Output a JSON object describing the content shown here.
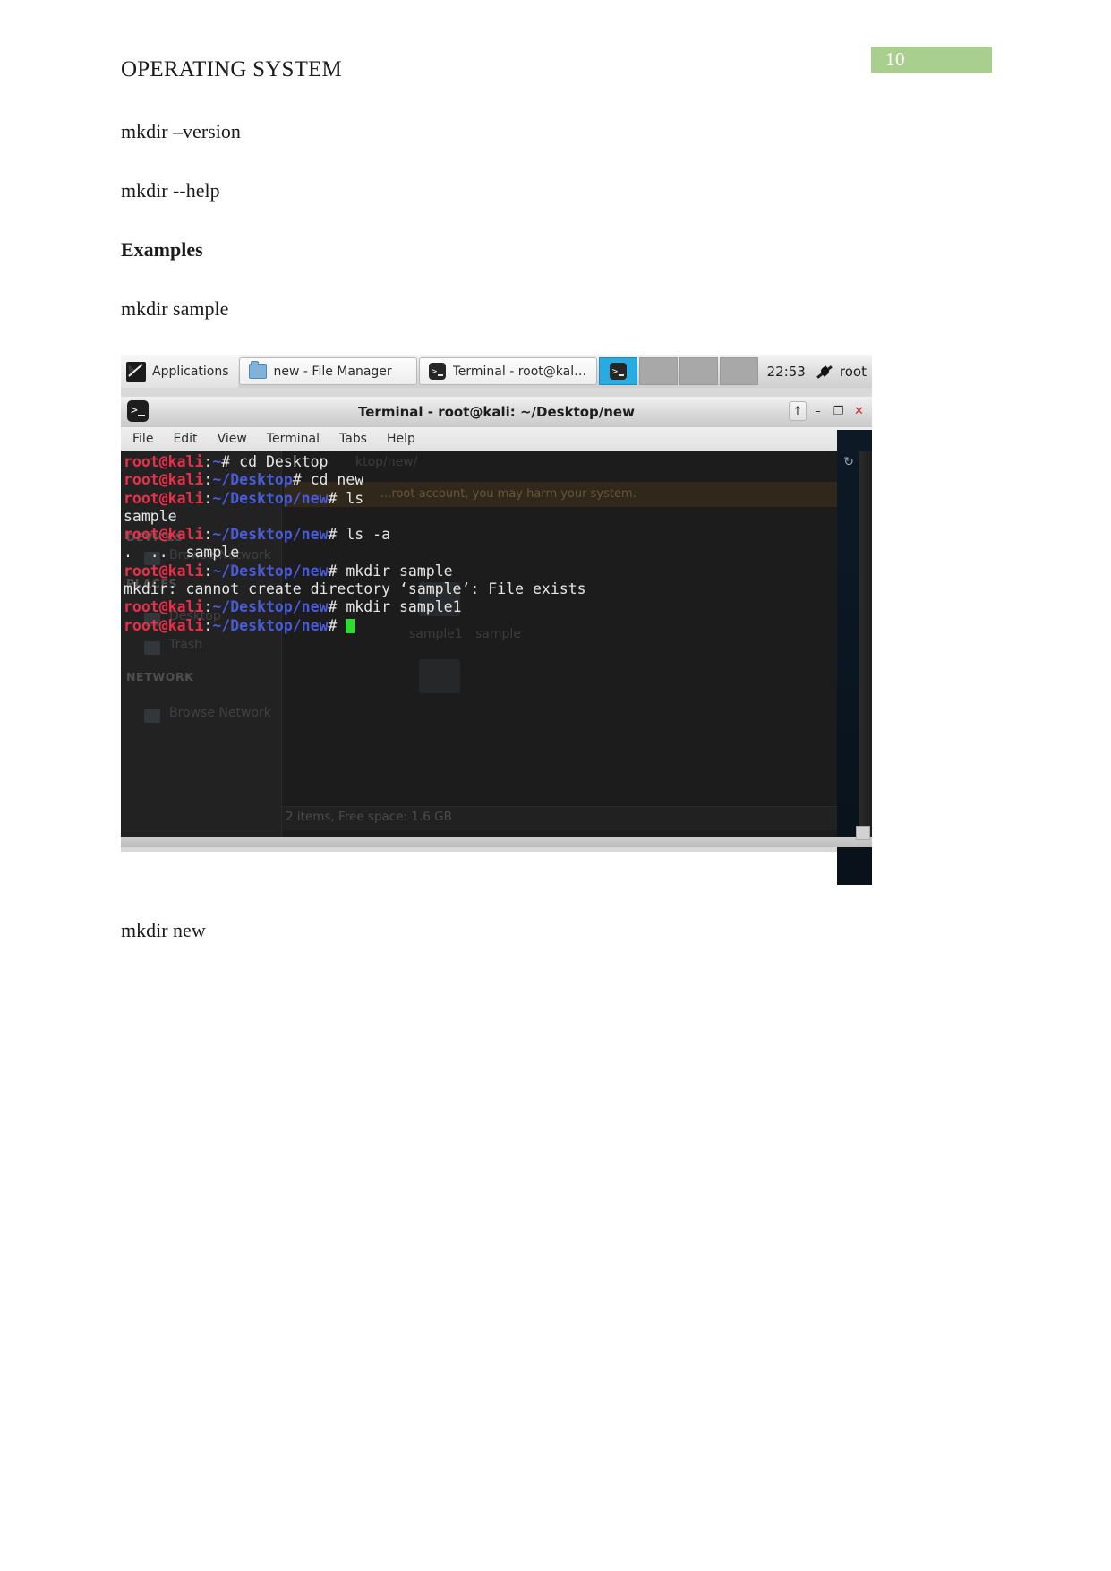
{
  "document": {
    "title": "OPERATING SYSTEM",
    "page_number": "10",
    "page_badge_color": "#a9cf8f",
    "paragraphs": [
      "mkdir –version",
      "mkdir --help",
      "Examples",
      "mkdir sample",
      "mkdir new"
    ]
  },
  "screenshot": {
    "panel": {
      "applications_label": "Applications",
      "applications_icon": "kali-dragon-icon",
      "tasks": [
        {
          "icon": "folder-icon",
          "label": "new - File Manager"
        },
        {
          "icon": "terminal-icon",
          "label": "Terminal - root@kali: ~/..."
        }
      ],
      "active_icon": "terminal-icon",
      "clock": "22:53",
      "tray_icon": "network-plug-icon",
      "user": "root"
    },
    "terminal_window": {
      "icon": "terminal-icon",
      "title": "Terminal - root@kali: ~/Desktop/new",
      "window_buttons": {
        "shade": "↑",
        "minimize": "–",
        "maximize": "❐",
        "close": "✕"
      },
      "menu": [
        "File",
        "Edit",
        "View",
        "Terminal",
        "Tabs",
        "Help"
      ],
      "reload_glyph": "↻",
      "lines": [
        {
          "type": "prompt",
          "user": "root@kali",
          "path": "~",
          "hash": "# ",
          "cmd": "cd Desktop"
        },
        {
          "type": "prompt",
          "user": "root@kali",
          "path": "~/Desktop",
          "hash": "# ",
          "cmd": "cd new"
        },
        {
          "type": "prompt",
          "user": "root@kali",
          "path": "~/Desktop/new",
          "hash": "# ",
          "cmd": "ls"
        },
        {
          "type": "output",
          "text": "sample"
        },
        {
          "type": "prompt",
          "user": "root@kali",
          "path": "~/Desktop/new",
          "hash": "# ",
          "cmd": "ls -a"
        },
        {
          "type": "output",
          "text": ".  ..  sample"
        },
        {
          "type": "prompt",
          "user": "root@kali",
          "path": "~/Desktop/new",
          "hash": "# ",
          "cmd": "mkdir sample"
        },
        {
          "type": "output",
          "text": "mkdir: cannot create directory ‘sample’: File exists"
        },
        {
          "type": "prompt",
          "user": "root@kali",
          "path": "~/Desktop/new",
          "hash": "# ",
          "cmd": "mkdir sample1"
        },
        {
          "type": "prompt-cursor",
          "user": "root@kali",
          "path": "~/Desktop/new",
          "hash": "# ",
          "cmd": ""
        }
      ]
    },
    "file_manager_ghost": {
      "sidebar_items": [
        "Desktop",
        "Trash",
        "Browse Network"
      ],
      "sidebar_headings": [
        "DEVICES",
        "PLACES",
        "NETWORK"
      ],
      "warning_text": "...root account, you may harm your system.",
      "path_text": "ktop/new/",
      "file_labels": [
        "sample1",
        "sample"
      ],
      "status_text": "2 items, Free space: 1.6 GB"
    }
  }
}
